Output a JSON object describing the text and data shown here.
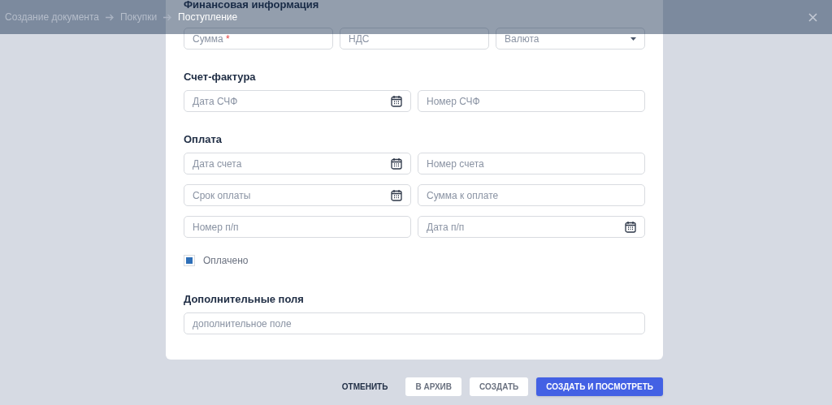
{
  "header": {
    "breadcrumbs": [
      {
        "label": "Создание документа",
        "current": false
      },
      {
        "label": "Покупки",
        "current": false
      },
      {
        "label": "Поступление",
        "current": true
      }
    ]
  },
  "sections": [
    {
      "title": "Финансовая информация",
      "rows": [
        [
          {
            "kind": "text",
            "placeholder": "Сумма",
            "required_mark": "*"
          },
          {
            "kind": "text",
            "placeholder": "НДС"
          },
          {
            "kind": "select",
            "placeholder": "Валюта"
          }
        ]
      ]
    },
    {
      "title": "Счет-фактура",
      "rows": [
        [
          {
            "kind": "date",
            "placeholder": "Дата СЧФ"
          },
          {
            "kind": "text",
            "placeholder": "Номер СЧФ"
          }
        ]
      ]
    },
    {
      "title": "Оплата",
      "rows": [
        [
          {
            "kind": "date",
            "placeholder": "Дата счета"
          },
          {
            "kind": "text",
            "placeholder": "Номер счета"
          }
        ],
        [
          {
            "kind": "date",
            "placeholder": "Срок оплаты"
          },
          {
            "kind": "text",
            "placeholder": "Сумма к оплате"
          }
        ],
        [
          {
            "kind": "text",
            "placeholder": "Номер п/п"
          },
          {
            "kind": "date",
            "placeholder": "Дата п/п"
          }
        ]
      ],
      "checkbox": {
        "label": "Оплачено",
        "checked": true
      }
    },
    {
      "title": "Дополнительные поля",
      "rows": [
        [
          {
            "kind": "text",
            "placeholder": "дополнительное поле"
          }
        ]
      ]
    }
  ],
  "buttons": [
    {
      "label": "ОТМЕНИТЬ",
      "kind": "text"
    },
    {
      "label": "В АРХИВ",
      "kind": "outline"
    },
    {
      "label": "СОЗДАТЬ",
      "kind": "outline"
    },
    {
      "label": "СОЗДАТЬ И ПОСМОТРЕТЬ",
      "kind": "primary"
    }
  ]
}
